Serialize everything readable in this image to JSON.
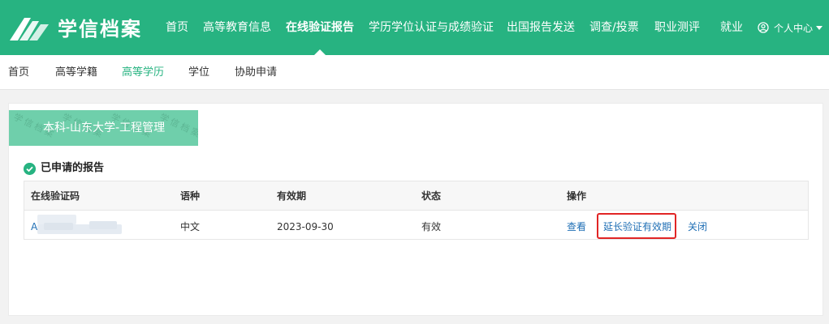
{
  "brand": {
    "name": "学信档案"
  },
  "nav": {
    "items": [
      {
        "label": "首页"
      },
      {
        "label": "高等教育信息"
      },
      {
        "label": "在线验证报告"
      },
      {
        "label": "学历学位认证与成绩验证"
      },
      {
        "label": "出国报告发送"
      },
      {
        "label": "调查/投票"
      },
      {
        "label": "职业测评"
      },
      {
        "label": "就业"
      }
    ],
    "active_index": 2,
    "user_menu": "个人中心",
    "user_icon": "user-circle-icon"
  },
  "subnav": {
    "items": [
      {
        "label": "首页"
      },
      {
        "label": "高等学籍"
      },
      {
        "label": "高等学历"
      },
      {
        "label": "学位"
      },
      {
        "label": "协助申请"
      }
    ],
    "active_index": 2
  },
  "degree": {
    "title": "本科-山东大学-工程管理"
  },
  "reports": {
    "section_title": "已申请的报告",
    "columns": [
      "在线验证码",
      "语种",
      "有效期",
      "状态",
      "操作"
    ],
    "rows": [
      {
        "code": "A",
        "language": "中文",
        "expiry": "2023-09-30",
        "status": "有效",
        "actions": [
          "查看",
          "延长验证有效期",
          "关闭"
        ]
      }
    ]
  },
  "colors": {
    "brand_green": "#27b381",
    "link_blue": "#1f6fb5",
    "highlight_red": "#e12525"
  }
}
